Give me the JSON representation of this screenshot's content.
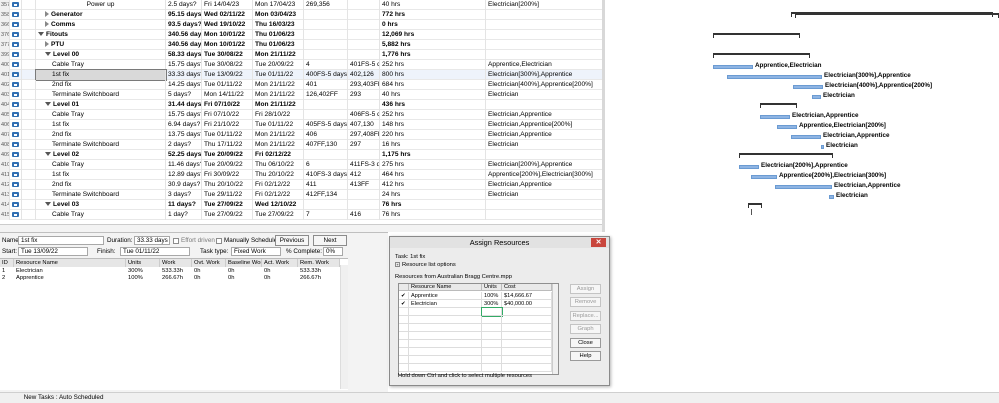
{
  "grid": {
    "rows": [
      {
        "id": "357",
        "name": "Power up",
        "level": 3,
        "bold": false,
        "dur": "2.5 days?",
        "start": "Fri 14/04/23",
        "finish": "Mon 17/04/23",
        "pred": "269,356",
        "succ": "",
        "work": "40 hrs",
        "res": "Electrician[200%]",
        "center": true
      },
      {
        "id": "358",
        "name": "Generator",
        "level": 2,
        "bold": true,
        "expand": "right",
        "dur": "95.15 days?",
        "start": "Wed 02/11/22",
        "finish": "Mon 03/04/23",
        "pred": "",
        "succ": "",
        "work": "772 hrs",
        "res": ""
      },
      {
        "id": "366",
        "name": "Comms",
        "level": 2,
        "bold": true,
        "expand": "right",
        "dur": "93.5 days?",
        "start": "Wed 19/10/22",
        "finish": "Thu 16/03/23",
        "pred": "",
        "succ": "",
        "work": "0 hrs",
        "res": ""
      },
      {
        "id": "376",
        "name": "Fitouts",
        "level": 1,
        "bold": true,
        "expand": "down",
        "dur": "340.56 days?",
        "start": "Mon 10/01/22",
        "finish": "Thu 01/06/23",
        "pred": "",
        "succ": "",
        "work": "12,069 hrs",
        "res": ""
      },
      {
        "id": "377",
        "name": "PTU",
        "level": 2,
        "bold": true,
        "expand": "right",
        "dur": "340.56 days?",
        "start": "Mon 10/01/22",
        "finish": "Thu 01/06/23",
        "pred": "",
        "succ": "",
        "work": "5,882 hrs",
        "res": ""
      },
      {
        "id": "399",
        "name": "Level 00",
        "level": 2,
        "bold": true,
        "expand": "down",
        "dur": "58.33 days?",
        "start": "Tue 30/08/22",
        "finish": "Mon 21/11/22",
        "pred": "",
        "succ": "",
        "work": "1,776 hrs",
        "res": ""
      },
      {
        "id": "400",
        "name": "Cable Tray",
        "level": 3,
        "bold": false,
        "dur": "15.75 days?",
        "start": "Tue 30/08/22",
        "finish": "Tue 20/09/22",
        "pred": "4",
        "succ": "401FS-5 da",
        "work": "252 hrs",
        "res": "Apprentice,Electrician"
      },
      {
        "id": "401",
        "name": "1st fix",
        "level": 3,
        "bold": false,
        "dur": "33.33 days?",
        "start": "Tue 13/09/22",
        "finish": "Tue 01/11/22",
        "pred": "400FS-5 days",
        "succ": "402,126",
        "work": "800 hrs",
        "res": "Electrician[300%],Apprentice",
        "selected": true
      },
      {
        "id": "402",
        "name": "2nd fix",
        "level": 3,
        "bold": false,
        "dur": "14.25 days?",
        "start": "Tue 01/11/22",
        "finish": "Mon 21/11/22",
        "pred": "401",
        "succ": "293,403FF",
        "work": "684 hrs",
        "res": "Electrician[400%],Apprentice[200%]"
      },
      {
        "id": "403",
        "name": "Terminate Switchboard",
        "level": 3,
        "bold": false,
        "dur": "5 days?",
        "start": "Mon 14/11/22",
        "finish": "Mon 21/11/22",
        "pred": "126,402FF",
        "succ": "293",
        "work": "40 hrs",
        "res": "Electrician"
      },
      {
        "id": "404",
        "name": "Level 01",
        "level": 2,
        "bold": true,
        "expand": "down",
        "dur": "31.44 days?",
        "start": "Fri 07/10/22",
        "finish": "Mon 21/11/22",
        "pred": "",
        "succ": "",
        "work": "436 hrs",
        "res": ""
      },
      {
        "id": "405",
        "name": "Cable Tray",
        "level": 3,
        "bold": false,
        "dur": "15.75 days?",
        "start": "Fri 07/10/22",
        "finish": "Fri 28/10/22",
        "pred": "",
        "succ": "406FS-5 da",
        "work": "252 hrs",
        "res": "Electrician,Apprentice"
      },
      {
        "id": "406",
        "name": "1st fix",
        "level": 3,
        "bold": false,
        "dur": "6.94 days?",
        "start": "Fri 21/10/22",
        "finish": "Tue 01/11/22",
        "pred": "405FS-5 days",
        "succ": "407,130",
        "work": "148 hrs",
        "res": "Electrician,Apprentice[200%]"
      },
      {
        "id": "407",
        "name": "2nd fix",
        "level": 3,
        "bold": false,
        "dur": "13.75 days?",
        "start": "Tue 01/11/22",
        "finish": "Mon 21/11/22",
        "pred": "406",
        "succ": "297,408FF",
        "work": "220 hrs",
        "res": "Electrician,Apprentice"
      },
      {
        "id": "408",
        "name": "Terminate Switchboard",
        "level": 3,
        "bold": false,
        "dur": "2 days?",
        "start": "Thu 17/11/22",
        "finish": "Mon 21/11/22",
        "pred": "407FF,130",
        "succ": "297",
        "work": "16 hrs",
        "res": "Electrician"
      },
      {
        "id": "409",
        "name": "Level 02",
        "level": 2,
        "bold": true,
        "expand": "down",
        "dur": "52.25 days?",
        "start": "Tue 20/09/22",
        "finish": "Fri 02/12/22",
        "pred": "",
        "succ": "",
        "work": "1,175 hrs",
        "res": ""
      },
      {
        "id": "410",
        "name": "Cable Tray",
        "level": 3,
        "bold": false,
        "dur": "11.46 days?",
        "start": "Tue 20/09/22",
        "finish": "Thu 06/10/22",
        "pred": "6",
        "succ": "411FS-3 da",
        "work": "275 hrs",
        "res": "Electrician[200%],Apprentice"
      },
      {
        "id": "411",
        "name": "1st fix",
        "level": 3,
        "bold": false,
        "dur": "12.89 days?",
        "start": "Fri 30/09/22",
        "finish": "Thu 20/10/22",
        "pred": "410FS-3 days",
        "succ": "412",
        "work": "464 hrs",
        "res": "Apprentice[200%],Electrician[300%]"
      },
      {
        "id": "412",
        "name": "2nd fix",
        "level": 3,
        "bold": false,
        "dur": "30.9 days?",
        "start": "Thu 20/10/22",
        "finish": "Fri 02/12/22",
        "pred": "411",
        "succ": "413FF",
        "work": "412 hrs",
        "res": "Electrician,Apprentice"
      },
      {
        "id": "413",
        "name": "Terminate Switchboard",
        "level": 3,
        "bold": false,
        "dur": "3 days?",
        "start": "Tue 29/11/22",
        "finish": "Fri 02/12/22",
        "pred": "412FF,134",
        "succ": "",
        "work": "24 hrs",
        "res": "Electrician"
      },
      {
        "id": "414",
        "name": "Level 03",
        "level": 2,
        "bold": true,
        "expand": "down",
        "dur": "11 days?",
        "start": "Tue 27/09/22",
        "finish": "Wed 12/10/22",
        "pred": "",
        "succ": "",
        "work": "76 hrs",
        "res": ""
      },
      {
        "id": "415",
        "name": "Cable Tray",
        "level": 3,
        "bold": false,
        "dur": "1 day?",
        "start": "Tue 27/09/22",
        "finish": "Tue 27/09/22",
        "pred": "7",
        "succ": "416",
        "work": "76 hrs",
        "res": ""
      }
    ]
  },
  "gantt": {
    "labels": [
      "Apprentice,Electrician",
      "Electrician[300%],Apprentice",
      "Electrician[400%],Apprentice[200%]",
      "Electrician",
      "Electrician,Apprentice",
      "Apprentice,Electrician[200%]",
      "Electrician,Apprentice",
      "Electrician",
      "Electrician[200%],Apprentice",
      "Apprentice[200%],Electrician[300%]",
      "Electrician,Apprentice",
      "Electrician"
    ]
  },
  "form": {
    "name_label": "Name:",
    "name_value": "1st fix",
    "duration_label": "Duration:",
    "duration_value": "33.33 days",
    "effort_driven_label": "Effort driven",
    "manually_scheduled_label": "Manually Scheduled",
    "previous_label": "Previous",
    "next_label": "Next",
    "start_label": "Start:",
    "start_value": "Tue 13/09/22",
    "finish_label": "Finish:",
    "finish_value": "Tue 01/11/22",
    "task_type_label": "Task type:",
    "task_type_value": "Fixed Work",
    "pct_complete_label": "% Complete:",
    "pct_complete_value": "0%",
    "columns": [
      "ID",
      "Resource Name",
      "Units",
      "Work",
      "Ovt. Work",
      "Baseline Work",
      "Act. Work",
      "Rem. Work"
    ],
    "rows": [
      {
        "id": "1",
        "name": "Electrician",
        "units": "300%",
        "work": "533.33h",
        "ovt": "0h",
        "base": "0h",
        "act": "0h",
        "rem": "533.33h"
      },
      {
        "id": "2",
        "name": "Apprentice",
        "units": "100%",
        "work": "266.67h",
        "ovt": "0h",
        "base": "0h",
        "act": "0h",
        "rem": "266.67h"
      }
    ]
  },
  "dialog": {
    "title": "Assign Resources",
    "close_glyph": "✕",
    "task_label": "Task: 1st fix",
    "list_options": "Resource list options",
    "from_label": "Resources from Australian Bragg Centre.mpp",
    "columns": [
      "Resource Name",
      "Units",
      "Cost"
    ],
    "rows": [
      {
        "check": "✔",
        "name": "Apprentice",
        "units": "100%",
        "cost": "$14,666.67"
      },
      {
        "check": "✔",
        "name": "Electrician",
        "units": "300%",
        "cost": "$40,000.00"
      }
    ],
    "buttons": {
      "assign": "Assign",
      "remove": "Remove",
      "replace": "Replace...",
      "graph": "Graph",
      "close": "Close",
      "help": "Help"
    },
    "hint": "Hold down Ctrl and click to select multiple resources"
  },
  "status": {
    "text": "New Tasks : Auto Scheduled"
  }
}
